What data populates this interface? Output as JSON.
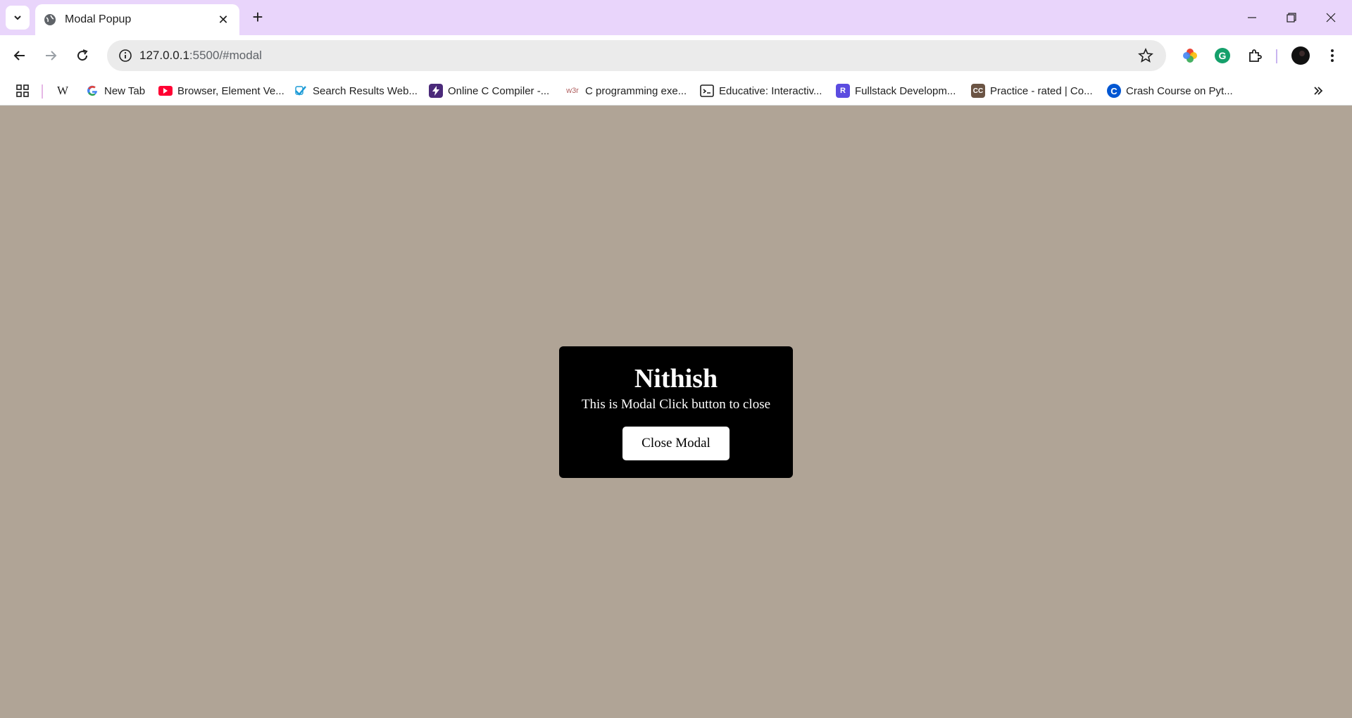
{
  "browser": {
    "tab": {
      "title": "Modal Popup"
    },
    "address": {
      "host": "127.0.0.1",
      "rest": ":5500/#modal"
    },
    "bookmarks": [
      {
        "label": "",
        "icon": "wikipedia-icon"
      },
      {
        "label": "New Tab",
        "icon": "google-icon"
      },
      {
        "label": "Browser, Element Ve...",
        "icon": "youtube-icon"
      },
      {
        "label": "Search Results Web...",
        "icon": "check-icon"
      },
      {
        "label": "Online C Compiler -...",
        "icon": "bolt-icon"
      },
      {
        "label": "C programming exe...",
        "icon": "w3r-icon"
      },
      {
        "label": "Educative: Interactiv...",
        "icon": "terminal-icon"
      },
      {
        "label": "Fullstack Developm...",
        "icon": "r-icon"
      },
      {
        "label": "Practice - rated | Co...",
        "icon": "cc-icon"
      },
      {
        "label": "Crash Course on Pyt...",
        "icon": "coursera-icon"
      }
    ]
  },
  "modal": {
    "title": "Nithish",
    "message": "This is Modal Click button to close",
    "close_label": "Close Modal"
  },
  "colors": {
    "tabstrip": "#e9d5fb",
    "page_background": "#b0a496",
    "modal_background": "#000000"
  }
}
